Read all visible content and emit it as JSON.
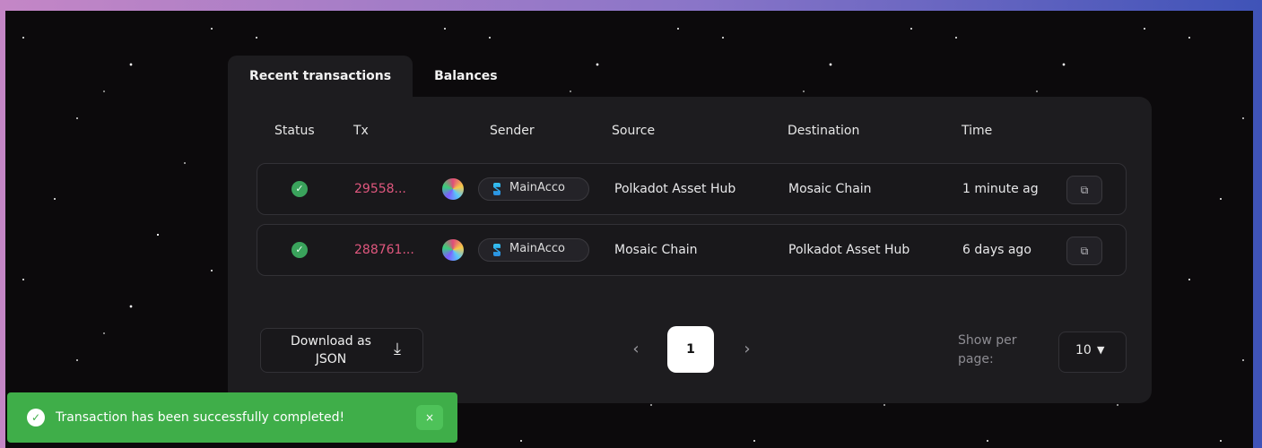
{
  "tabs": [
    {
      "label": "Recent transactions"
    },
    {
      "label": "Balances"
    }
  ],
  "table": {
    "columns": [
      "Status",
      "Tx",
      "Sender",
      "Source",
      "Destination",
      "Time"
    ],
    "rows": [
      {
        "status": "success",
        "tx": "29558...",
        "sender": "MainAcco",
        "source": "Polkadot Asset Hub",
        "destination": "Mosaic Chain",
        "time": "1 minute ag"
      },
      {
        "status": "success",
        "tx": "288761...",
        "sender": "MainAcco",
        "source": "Mosaic Chain",
        "destination": "Polkadot Asset Hub",
        "time": "6 days ago"
      }
    ]
  },
  "download": {
    "label": "Download as JSON",
    "icon": "download-icon"
  },
  "pagination": {
    "prev": "‹",
    "page": "1",
    "next": "›"
  },
  "per_page": {
    "label": "Show per page:",
    "value": "10"
  },
  "toast": {
    "message": "Transaction has been successfully completed!",
    "close": "×"
  },
  "colors": {
    "accent_tx": "#e0577e",
    "success": "#3aa35c",
    "toast_bg": "#3fae49"
  }
}
